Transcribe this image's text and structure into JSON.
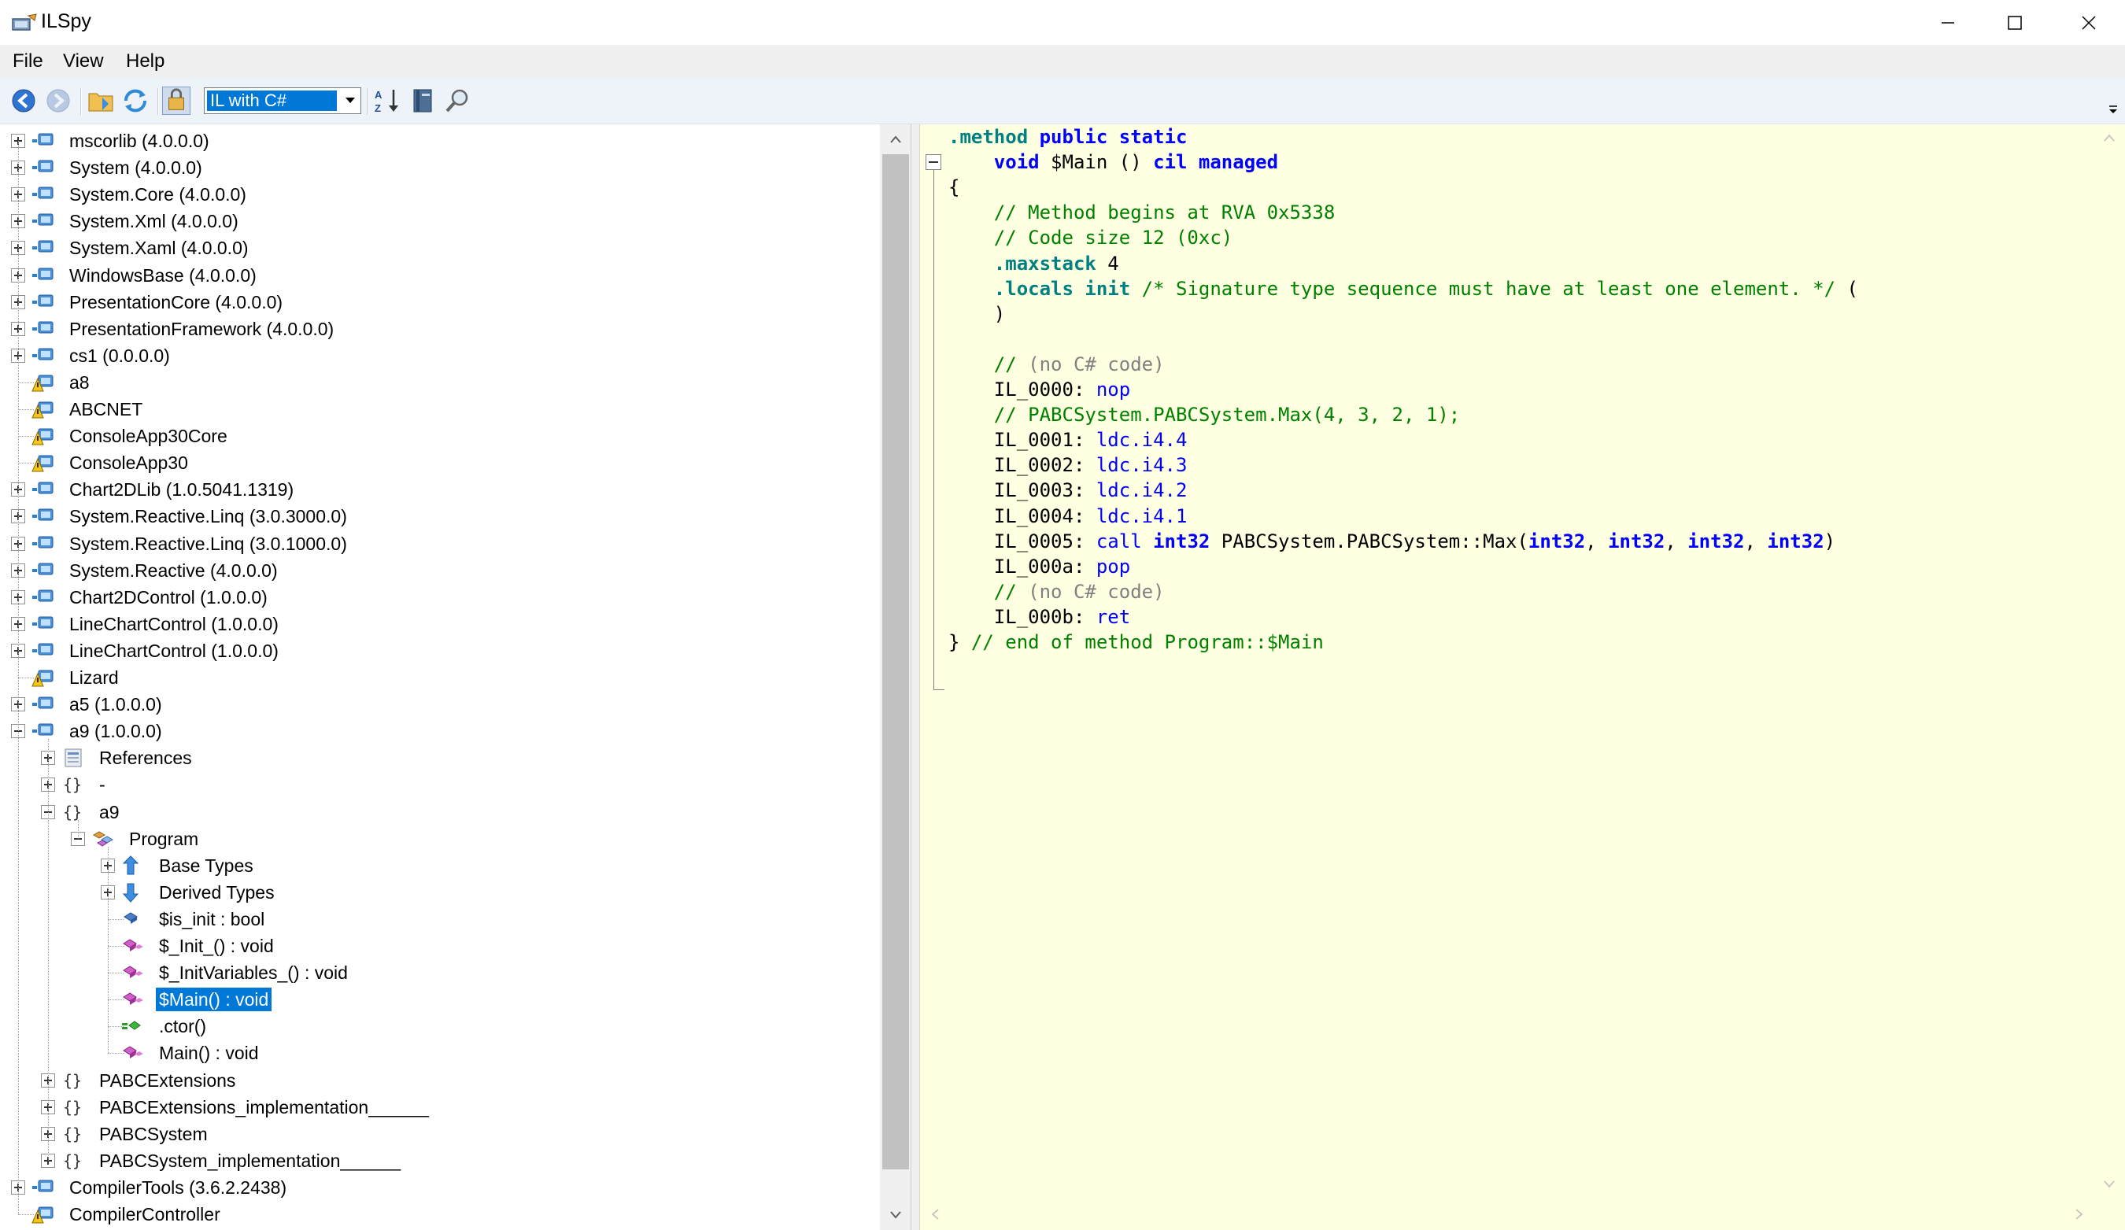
{
  "window": {
    "title": "ILSpy",
    "controls": [
      "minimize",
      "maximize",
      "close"
    ]
  },
  "menu": {
    "items": [
      "File",
      "View",
      "Help"
    ]
  },
  "toolbar": {
    "icons": [
      "back-icon",
      "forward-icon",
      "open-icon",
      "reload-icon",
      "show-internal-icon",
      "sort-icon",
      "assembly-list-icon",
      "search-icon"
    ],
    "language": "IL with C#"
  },
  "tree": {
    "rows": [
      {
        "label": "mscorlib (4.0.0.0)",
        "icon": "assembly"
      },
      {
        "label": "System (4.0.0.0)",
        "icon": "assembly"
      },
      {
        "label": "System.Core (4.0.0.0)",
        "icon": "assembly"
      },
      {
        "label": "System.Xml (4.0.0.0)",
        "icon": "assembly"
      },
      {
        "label": "System.Xaml (4.0.0.0)",
        "icon": "assembly"
      },
      {
        "label": "WindowsBase (4.0.0.0)",
        "icon": "assembly"
      },
      {
        "label": "PresentationCore (4.0.0.0)",
        "icon": "assembly"
      },
      {
        "label": "PresentationFramework (4.0.0.0)",
        "icon": "assembly"
      },
      {
        "label": "cs1 (0.0.0.0)",
        "icon": "assembly"
      },
      {
        "label": "a8",
        "icon": "assembly-warning"
      },
      {
        "label": "ABCNET",
        "icon": "assembly-warning"
      },
      {
        "label": "ConsoleApp30Core",
        "icon": "assembly-warning"
      },
      {
        "label": "ConsoleApp30",
        "icon": "assembly-warning"
      },
      {
        "label": "Chart2DLib (1.0.5041.1319)",
        "icon": "assembly"
      },
      {
        "label": "System.Reactive.Linq (3.0.3000.0)",
        "icon": "assembly"
      },
      {
        "label": "System.Reactive.Linq (3.0.1000.0)",
        "icon": "assembly"
      },
      {
        "label": "System.Reactive (4.0.0.0)",
        "icon": "assembly"
      },
      {
        "label": "Chart2DControl (1.0.0.0)",
        "icon": "assembly"
      },
      {
        "label": "LineChartControl (1.0.0.0)",
        "icon": "assembly"
      },
      {
        "label": "LineChartControl (1.0.0.0)",
        "icon": "assembly"
      },
      {
        "label": "Lizard",
        "icon": "assembly-warning"
      },
      {
        "label": "a5 (1.0.0.0)",
        "icon": "assembly"
      },
      {
        "label": "a9 (1.0.0.0)",
        "icon": "assembly"
      },
      {
        "label": "References",
        "icon": "references"
      },
      {
        "label": "-",
        "icon": "namespace"
      },
      {
        "label": "a9",
        "icon": "namespace"
      },
      {
        "label": "Program",
        "icon": "class"
      },
      {
        "label": "Base Types",
        "icon": "base-types"
      },
      {
        "label": "Derived Types",
        "icon": "derived-types"
      },
      {
        "label": "$is_init : bool",
        "icon": "field"
      },
      {
        "label": "$_Init_() : void",
        "icon": "method"
      },
      {
        "label": "$_InitVariables_() : void",
        "icon": "method"
      },
      {
        "label": "$Main() : void",
        "icon": "method",
        "selected": true
      },
      {
        "label": ".ctor()",
        "icon": "constructor"
      },
      {
        "label": "Main() : void",
        "icon": "method"
      },
      {
        "label": "PABCExtensions",
        "icon": "namespace"
      },
      {
        "label": "PABCExtensions_implementation______",
        "icon": "namespace"
      },
      {
        "label": "PABCSystem",
        "icon": "namespace"
      },
      {
        "label": "PABCSystem_implementation______",
        "icon": "namespace"
      },
      {
        "label": "CompilerTools (3.6.2.2438)",
        "icon": "assembly"
      },
      {
        "label": "CompilerController",
        "icon": "assembly-warning"
      }
    ]
  },
  "code": {
    "lines": [
      [
        {
          "t": ".method ",
          "c": "dir"
        },
        {
          "t": "public static",
          "c": "kw"
        }
      ],
      [
        {
          "t": "    "
        },
        {
          "t": "void",
          "c": "kw"
        },
        {
          "t": " $Main () "
        },
        {
          "t": "cil managed",
          "c": "kw"
        }
      ],
      [
        {
          "t": "{"
        }
      ],
      [
        {
          "t": "    "
        },
        {
          "t": "// Method begins at RVA 0x5338",
          "c": "cmt"
        }
      ],
      [
        {
          "t": "    "
        },
        {
          "t": "// Code size 12 (0xc)",
          "c": "cmt"
        }
      ],
      [
        {
          "t": "    "
        },
        {
          "t": ".maxstack",
          "c": "dir"
        },
        {
          "t": " 4"
        }
      ],
      [
        {
          "t": "    "
        },
        {
          "t": ".locals init",
          "c": "dir"
        },
        {
          "t": " "
        },
        {
          "t": "/* Signature type sequence must have at least one element. */",
          "c": "cmt"
        },
        {
          "t": " ("
        }
      ],
      [
        {
          "t": "    )"
        }
      ],
      [
        {
          "t": ""
        }
      ],
      [
        {
          "t": "    "
        },
        {
          "t": "// ",
          "c": "cmt"
        },
        {
          "t": "(no C# code)",
          "c": "gray"
        }
      ],
      [
        {
          "t": "    IL_0000: "
        },
        {
          "t": "nop",
          "c": "op"
        }
      ],
      [
        {
          "t": "    "
        },
        {
          "t": "// PABCSystem.PABCSystem.Max(4, 3, 2, 1);",
          "c": "cmt"
        }
      ],
      [
        {
          "t": "    IL_0001: "
        },
        {
          "t": "ldc.i4.4",
          "c": "op"
        }
      ],
      [
        {
          "t": "    IL_0002: "
        },
        {
          "t": "ldc.i4.3",
          "c": "op"
        }
      ],
      [
        {
          "t": "    IL_0003: "
        },
        {
          "t": "ldc.i4.2",
          "c": "op"
        }
      ],
      [
        {
          "t": "    IL_0004: "
        },
        {
          "t": "ldc.i4.1",
          "c": "op"
        }
      ],
      [
        {
          "t": "    IL_0005: "
        },
        {
          "t": "call",
          "c": "op"
        },
        {
          "t": " "
        },
        {
          "t": "int32",
          "c": "kw"
        },
        {
          "t": " PABCSystem.PABCSystem::Max("
        },
        {
          "t": "int32",
          "c": "kw"
        },
        {
          "t": ", "
        },
        {
          "t": "int32",
          "c": "kw"
        },
        {
          "t": ", "
        },
        {
          "t": "int32",
          "c": "kw"
        },
        {
          "t": ", "
        },
        {
          "t": "int32",
          "c": "kw"
        },
        {
          "t": ")"
        }
      ],
      [
        {
          "t": "    IL_000a: "
        },
        {
          "t": "pop",
          "c": "op"
        }
      ],
      [
        {
          "t": "    "
        },
        {
          "t": "// ",
          "c": "cmt"
        },
        {
          "t": "(no C# code)",
          "c": "gray"
        }
      ],
      [
        {
          "t": "    IL_000b: "
        },
        {
          "t": "ret",
          "c": "op"
        }
      ],
      [
        {
          "t": "} "
        },
        {
          "t": "// end of method Program::$Main",
          "c": "cmt"
        }
      ]
    ]
  }
}
